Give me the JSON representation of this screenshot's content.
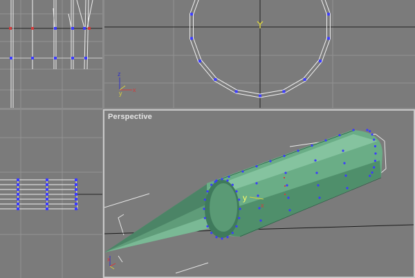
{
  "viewports": {
    "left": {
      "axes": []
    },
    "front": {
      "axes": [
        "z",
        "y",
        "x"
      ]
    },
    "bottom_left": {
      "axes": []
    },
    "perspective": {
      "label": "Perspective",
      "active": true,
      "axes": [
        "y",
        "x"
      ]
    }
  },
  "colors": {
    "viewport_bg": "#7b7b7b",
    "frame_bg": "#8c8c8c",
    "grid_line": "#939393",
    "wire": "#ffffff",
    "vertex": "#3b3bff",
    "mesh_fill": "#6fb18b",
    "mesh_dark": "#3f7a5c",
    "axis_x": "#d23c3c",
    "axis_y": "#d8d040",
    "axis_z": "#3030c8"
  }
}
